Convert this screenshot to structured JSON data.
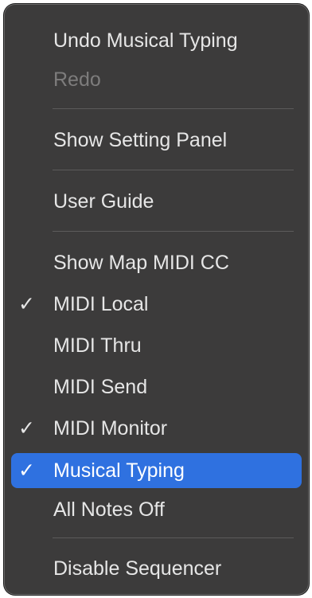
{
  "menu": {
    "items": [
      {
        "label": "Undo Musical Typing",
        "check": "",
        "disabled": false
      },
      {
        "label": "Redo",
        "check": "",
        "disabled": true
      },
      {
        "label": "Show Setting Panel",
        "check": ""
      },
      {
        "label": "User Guide",
        "check": ""
      },
      {
        "label": "Show Map MIDI CC",
        "check": ""
      },
      {
        "label": "MIDI Local",
        "check": "✓"
      },
      {
        "label": "MIDI Thru",
        "check": ""
      },
      {
        "label": "MIDI Send",
        "check": ""
      },
      {
        "label": "MIDI Monitor",
        "check": "✓"
      },
      {
        "label": "Musical Typing",
        "check": "✓",
        "highlighted": true
      },
      {
        "label": "All Notes Off",
        "check": ""
      },
      {
        "label": "Disable Sequencer",
        "check": ""
      }
    ]
  },
  "colors": {
    "menu_background": "#3c3b3b",
    "highlight": "#2f71e0",
    "text": "#e6e6e6",
    "disabled_text": "#7d7c7c"
  }
}
